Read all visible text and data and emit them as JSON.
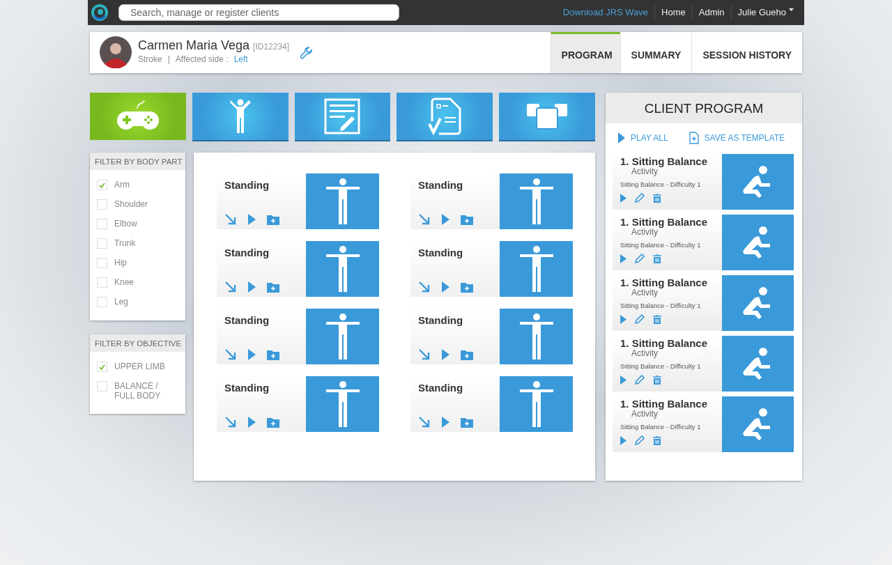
{
  "top_bar": {
    "search": {
      "placeholder": "Search, manage or register clients"
    },
    "links": [
      {
        "label": "Download JRS Wave",
        "kind": "accent"
      },
      {
        "label": "Home",
        "kind": "plain"
      },
      {
        "label": "Admin",
        "kind": "plain"
      },
      {
        "label": "Julie Gueho",
        "kind": "menu"
      }
    ]
  },
  "client": {
    "name": "Carmen Maria Vega",
    "id": "[ID12234]",
    "condition": "Stroke",
    "separator": "|",
    "side_label": "Affected side :",
    "side": "Left"
  },
  "tabs": [
    {
      "label": "PROGRAM",
      "selected": true
    },
    {
      "label": "SUMMARY",
      "selected": false
    },
    {
      "label": "SESSION HISTORY",
      "selected": false
    }
  ],
  "categories": [
    {
      "kind": "games",
      "selected": true
    },
    {
      "kind": "exercises",
      "selected": false
    },
    {
      "kind": "notes",
      "selected": false
    },
    {
      "kind": "assessments",
      "selected": false
    },
    {
      "kind": "templates",
      "selected": false
    }
  ],
  "filters": [
    {
      "title": "FILTER BY BODY PART",
      "items": [
        {
          "label": "Arm",
          "checked": true
        },
        {
          "label": "Shoulder",
          "checked": false
        },
        {
          "label": "Elbow",
          "checked": false
        },
        {
          "label": "Trunk",
          "checked": false
        },
        {
          "label": "Hip",
          "checked": false
        },
        {
          "label": "Knee",
          "checked": false
        },
        {
          "label": "Leg",
          "checked": false
        }
      ]
    },
    {
      "title": "FILTER BY OBJECTIVE",
      "items": [
        {
          "label": "UPPER LIMB",
          "checked": true
        },
        {
          "label": "BALANCE / FULL BODY",
          "checked": false
        }
      ]
    }
  ],
  "exercises": [
    {
      "title": "Standing"
    },
    {
      "title": "Standing"
    },
    {
      "title": "Standing"
    },
    {
      "title": "Standing"
    },
    {
      "title": "Standing"
    },
    {
      "title": "Standing"
    },
    {
      "title": "Standing"
    },
    {
      "title": "Standing"
    }
  ],
  "client_program": {
    "title": "CLIENT PROGRAM",
    "actions": [
      {
        "label": "PLAY ALL",
        "kind": "play"
      },
      {
        "label": "SAVE AS TEMPLATE",
        "kind": "template"
      }
    ],
    "items": [
      {
        "title": "1. Sitting Balance",
        "type": "Activity",
        "detail": "Sitting Balance - Difficulty 1"
      },
      {
        "title": "1. Sitting Balance",
        "type": "Activity",
        "detail": "Sitting Balance - Difficulty 1"
      },
      {
        "title": "1. Sitting Balance",
        "type": "Activity",
        "detail": "Sitting Balance - Difficulty 1"
      },
      {
        "title": "1. Sitting Balance",
        "type": "Activity",
        "detail": "Sitting Balance - Difficulty 1"
      },
      {
        "title": "1. Sitting Balance",
        "type": "Activity",
        "detail": "Sitting Balance - Difficulty 1"
      }
    ]
  }
}
